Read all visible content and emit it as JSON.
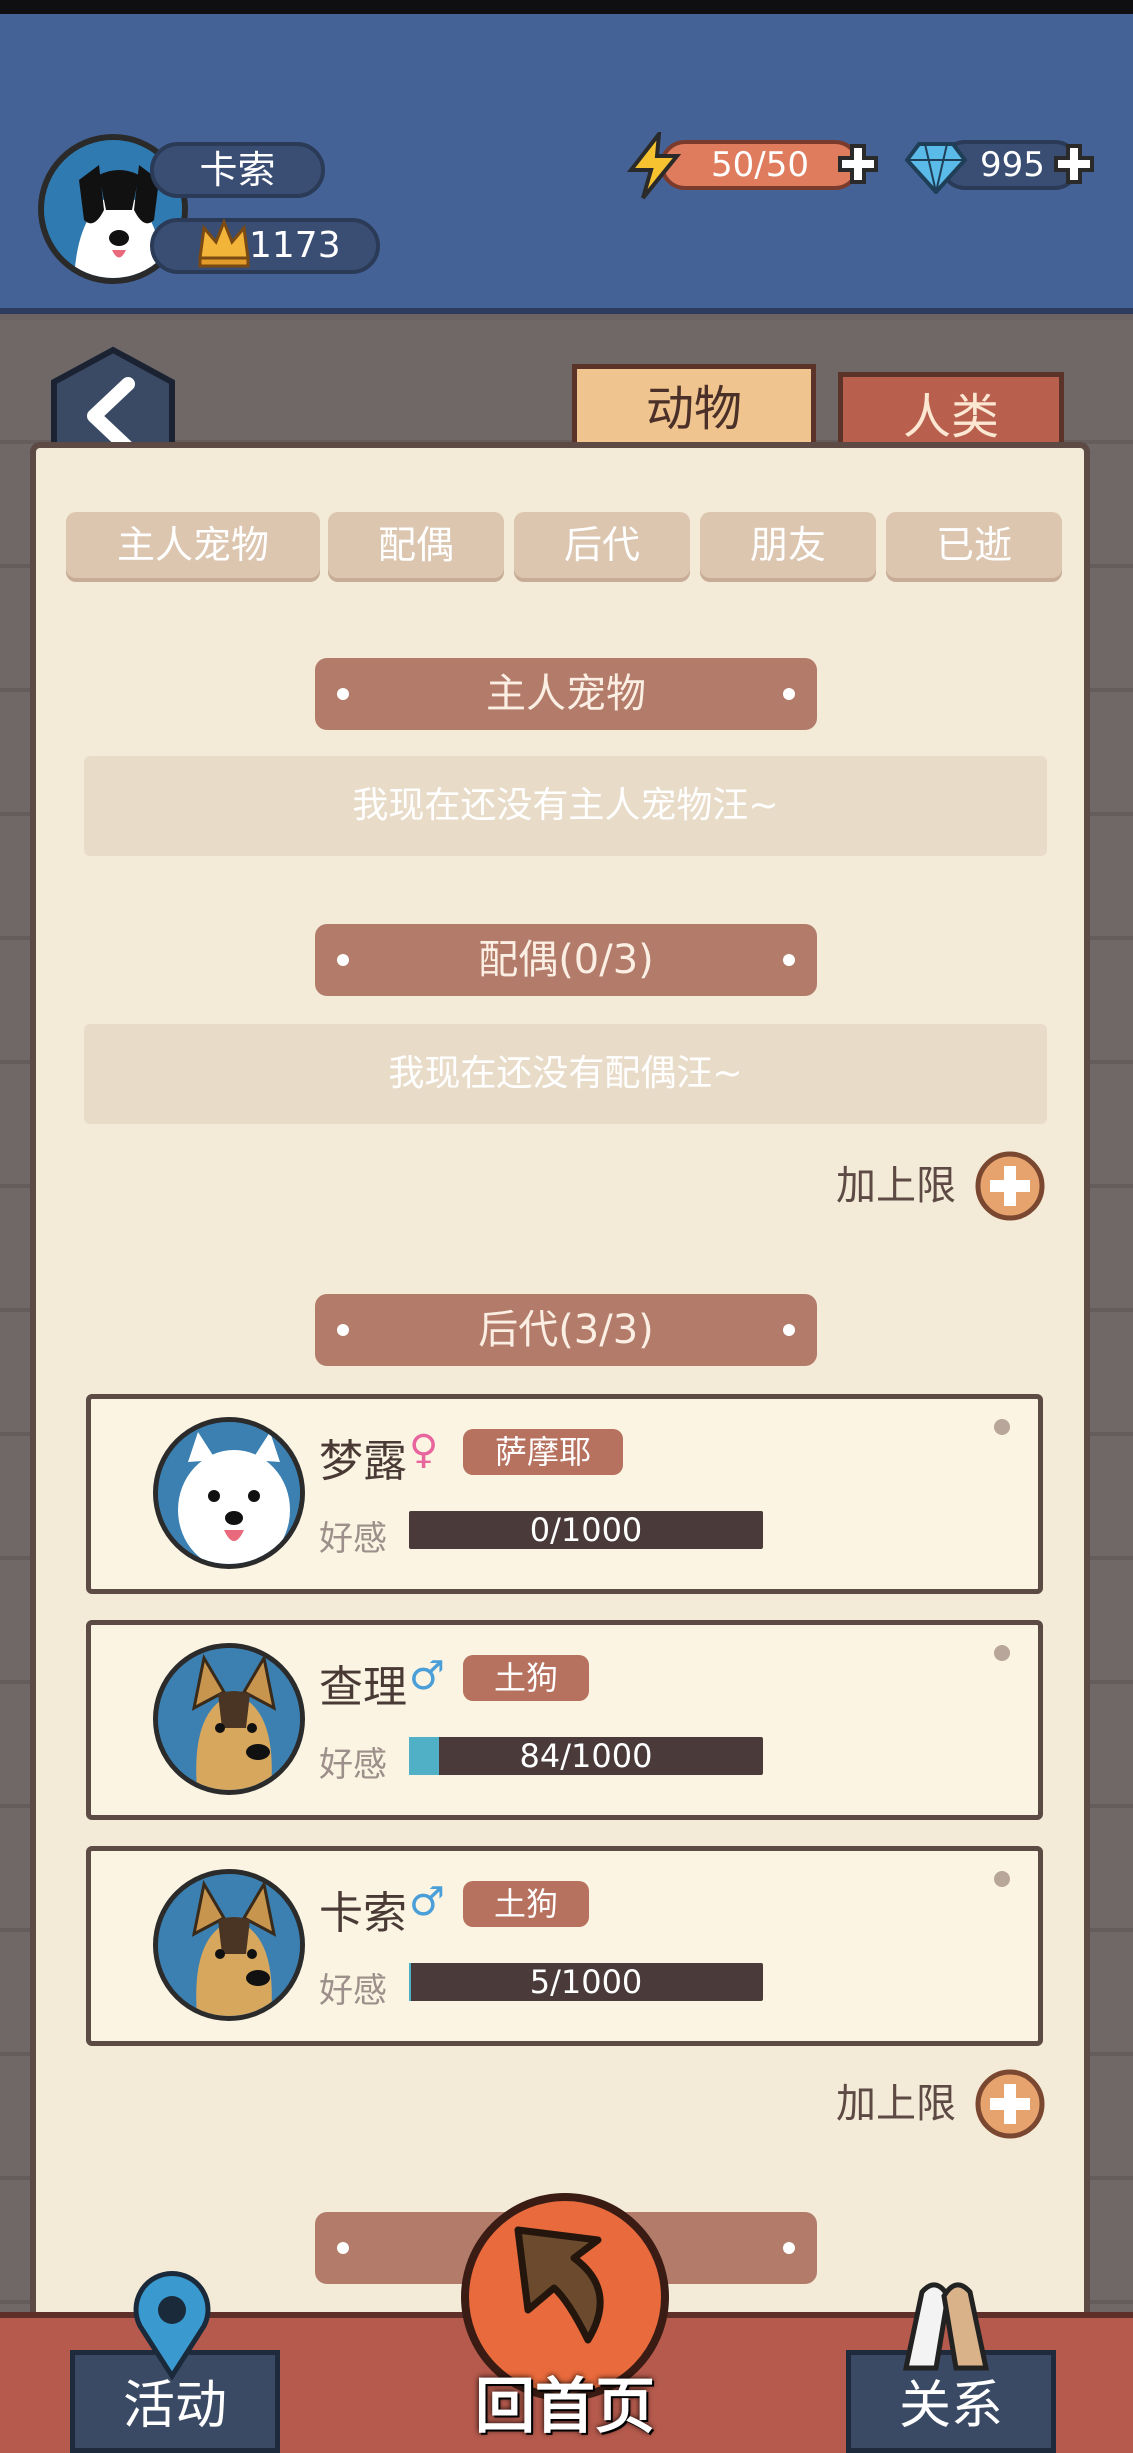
{
  "player": {
    "name": "卡索",
    "score": "1173",
    "energy": "50/50",
    "gems": "995"
  },
  "main_tabs": [
    {
      "label": "动物"
    },
    {
      "label": "人类"
    }
  ],
  "sub_tabs": [
    {
      "label": "主人宠物"
    },
    {
      "label": "配偶"
    },
    {
      "label": "后代"
    },
    {
      "label": "朋友"
    },
    {
      "label": "已逝"
    }
  ],
  "sections": {
    "owner_pet": {
      "title": "主人宠物",
      "empty": "我现在还没有主人宠物汪~"
    },
    "spouse": {
      "title": "配偶(0/3)",
      "empty": "我现在还没有配偶汪~",
      "add_limit": "加上限"
    },
    "offspring": {
      "title": "后代(3/3)",
      "add_limit": "加上限"
    }
  },
  "offspring": [
    {
      "name": "梦露",
      "gender": "♀",
      "breed": "萨摩耶",
      "favor_label": "好感",
      "favor_text": "0/1000",
      "favor_fraction": 0.0
    },
    {
      "name": "查理",
      "gender": "♂",
      "breed": "土狗",
      "favor_label": "好感",
      "favor_text": "84/1000",
      "favor_fraction": 0.084
    },
    {
      "name": "卡索",
      "gender": "♂",
      "breed": "土狗",
      "favor_label": "好感",
      "favor_text": "5/1000",
      "favor_fraction": 0.005
    }
  ],
  "bottom_nav": {
    "activity": "活动",
    "home": "回首页",
    "relations": "关系"
  },
  "colors": {
    "header": "#456296",
    "paper": "#f3ead7",
    "section": "#b27b6a",
    "breed_tag": "#b7725f",
    "favor_fill": "#4fb0c6"
  }
}
